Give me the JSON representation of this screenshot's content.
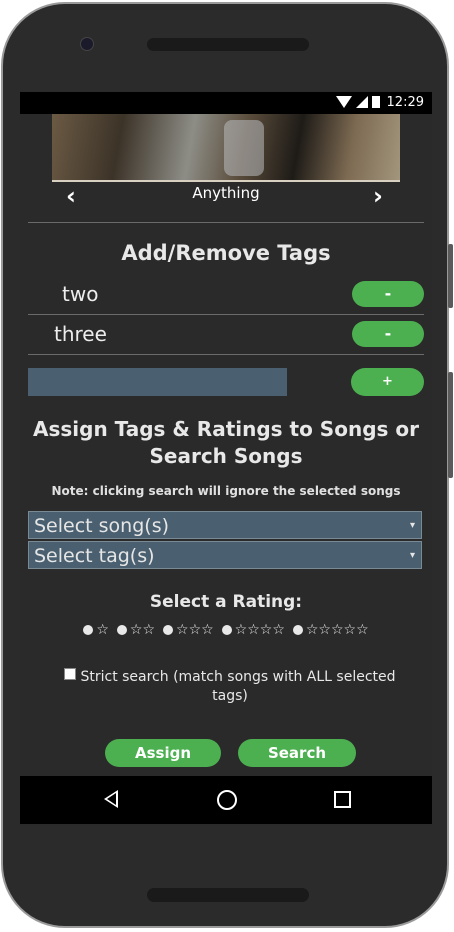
{
  "status_bar": {
    "time": "12:29"
  },
  "player": {
    "album_title": "Anything",
    "prev_icon": "‹",
    "next_icon": "›"
  },
  "tags_section": {
    "heading": "Add/Remove Tags",
    "tags": [
      {
        "label": "two",
        "remove_label": "-"
      },
      {
        "label": "three",
        "remove_label": "-"
      }
    ],
    "new_tag_value": "",
    "add_label": "+"
  },
  "assign_section": {
    "heading": "Assign Tags & Ratings to Songs or Search Songs",
    "note": "Note: clicking search will ignore the selected songs",
    "song_select": "Select song(s)",
    "tag_select": "Select tag(s)",
    "caret": "▾"
  },
  "rating_section": {
    "heading": "Select a Rating:",
    "options": [
      "☆",
      "☆☆",
      "☆☆☆",
      "☆☆☆☆",
      "☆☆☆☆☆"
    ]
  },
  "strict_search": {
    "label": "Strict search (match songs with ALL selected tags)",
    "checked": false
  },
  "actions": {
    "assign_label": "Assign",
    "search_label": "Search"
  },
  "colors": {
    "accent": "#4caf50",
    "input_bg": "#4a6070",
    "screen_bg": "#2a2a2a"
  }
}
